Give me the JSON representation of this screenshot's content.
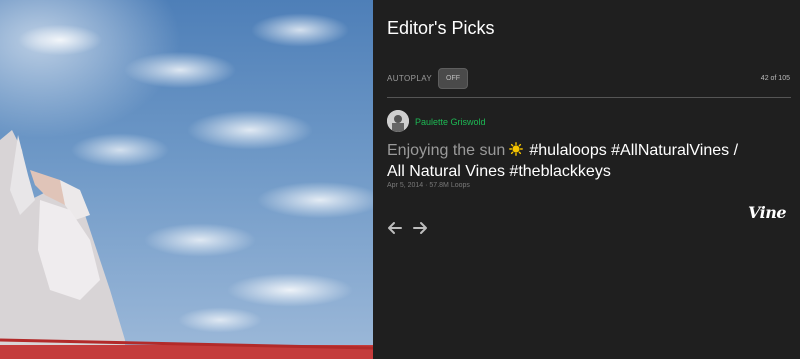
{
  "panel": {
    "title": "Editor's Picks",
    "autoplay_label": "AUTOPLAY",
    "autoplay_state": "OFF",
    "counter": "42 of 105"
  },
  "post": {
    "author": "Paulette Griswold",
    "caption_lead": "Enjoying the sun",
    "caption_tags_line1": "#hulaloops #AllNaturalVines /",
    "caption_line2": "All Natural Vines #theblackkeys",
    "meta": "Apr 5, 2014 · 57.8M Loops"
  },
  "branding": {
    "logo": "Vine"
  },
  "icons": {
    "sun": "sun-emoji-icon",
    "prev": "arrow-left-icon",
    "next": "arrow-right-icon"
  },
  "colors": {
    "background": "#1f1f1f",
    "author": "#1db954",
    "sun": "#f5c400"
  }
}
